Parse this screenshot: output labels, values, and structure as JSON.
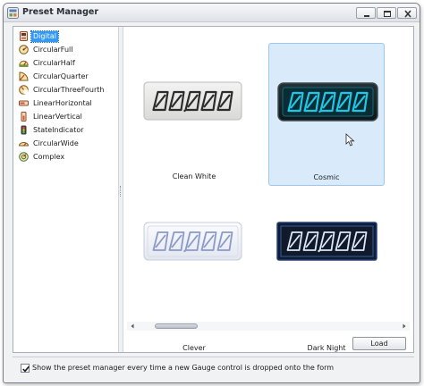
{
  "window": {
    "title": "Preset Manager"
  },
  "tree": {
    "items": [
      {
        "label": "Digital",
        "selected": true,
        "icon": "digital-gauge-icon"
      },
      {
        "label": "CircularFull",
        "selected": false,
        "icon": "circular-full-icon"
      },
      {
        "label": "CircularHalf",
        "selected": false,
        "icon": "circular-half-icon"
      },
      {
        "label": "CircularQuarter",
        "selected": false,
        "icon": "circular-quarter-icon"
      },
      {
        "label": "CircularThreeFourth",
        "selected": false,
        "icon": "circular-three-fourth-icon"
      },
      {
        "label": "LinearHorizontal",
        "selected": false,
        "icon": "linear-horizontal-icon"
      },
      {
        "label": "LinearVertical",
        "selected": false,
        "icon": "linear-vertical-icon"
      },
      {
        "label": "StateIndicator",
        "selected": false,
        "icon": "state-indicator-icon"
      },
      {
        "label": "CircularWide",
        "selected": false,
        "icon": "circular-wide-icon"
      },
      {
        "label": "Complex",
        "selected": false,
        "icon": "complex-gauge-icon"
      }
    ]
  },
  "gallery": {
    "presets": [
      {
        "label": "Clean White",
        "display": "00,000",
        "selected": false
      },
      {
        "label": "Cosmic",
        "display": "00,000",
        "selected": true
      },
      {
        "label": "Clever",
        "display": "00,000",
        "selected": false
      },
      {
        "label": "Dark Night",
        "display": "00,000",
        "selected": false
      }
    ]
  },
  "buttons": {
    "load": "Load"
  },
  "footer": {
    "show_on_drop_checked": true,
    "show_on_drop_label": "Show the preset manager every time a new Gauge control is dropped onto the form"
  },
  "colors": {
    "selection": "#3399ff",
    "selected_card": "#d9ebfb",
    "cosmic_digit": "#1ec8e6",
    "clean_white_digit": "#2c2c2c",
    "clever_digit": "#8a9ac8",
    "dark_night_digit": "#dfe8f5"
  }
}
